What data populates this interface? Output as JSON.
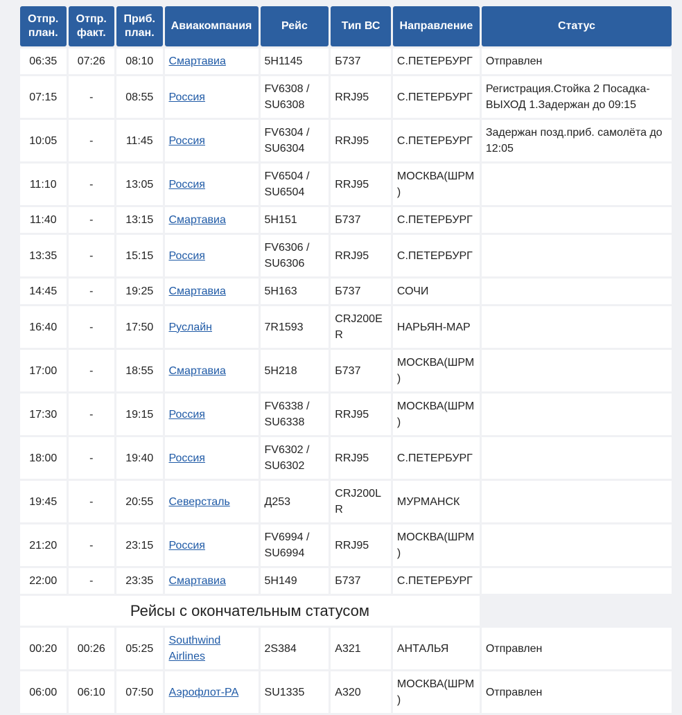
{
  "headers": {
    "dep_plan": "Отпр. план.",
    "dep_fact": "Отпр. факт.",
    "arr_plan": "Приб. план.",
    "airline": "Авиакомпания",
    "flight": "Рейс",
    "aircraft": "Тип ВС",
    "destination": "Направление",
    "status": "Статус"
  },
  "flights": [
    {
      "dep_plan": "06:35",
      "dep_fact": "07:26",
      "arr_plan": "08:10",
      "airline": "Смартавиа",
      "flight": "5Н1145",
      "aircraft": "Б737",
      "destination": "С.ПЕТЕРБУРГ",
      "status": "Отправлен"
    },
    {
      "dep_plan": "07:15",
      "dep_fact": "-",
      "arr_plan": "08:55",
      "airline": "Россия",
      "flight": "FV6308 / SU6308",
      "aircraft": "RRJ95",
      "destination": "С.ПЕТЕРБУРГ",
      "status": "Регистрация.Стойка 2 Посадка-ВЫХОД 1.Задержан до 09:15"
    },
    {
      "dep_plan": "10:05",
      "dep_fact": "-",
      "arr_plan": "11:45",
      "airline": "Россия",
      "flight": "FV6304 / SU6304",
      "aircraft": "RRJ95",
      "destination": "С.ПЕТЕРБУРГ",
      "status": "Задержан позд.приб. самолёта до 12:05"
    },
    {
      "dep_plan": "11:10",
      "dep_fact": "-",
      "arr_plan": "13:05",
      "airline": "Россия",
      "flight": "FV6504 / SU6504",
      "aircraft": "RRJ95",
      "destination": "МОСКВА(ШРМ)",
      "status": ""
    },
    {
      "dep_plan": "11:40",
      "dep_fact": "-",
      "arr_plan": "13:15",
      "airline": "Смартавиа",
      "flight": "5Н151",
      "aircraft": "Б737",
      "destination": "С.ПЕТЕРБУРГ",
      "status": ""
    },
    {
      "dep_plan": "13:35",
      "dep_fact": "-",
      "arr_plan": "15:15",
      "airline": "Россия",
      "flight": "FV6306 / SU6306",
      "aircraft": "RRJ95",
      "destination": "С.ПЕТЕРБУРГ",
      "status": ""
    },
    {
      "dep_plan": "14:45",
      "dep_fact": "-",
      "arr_plan": "19:25",
      "airline": "Смартавиа",
      "flight": "5Н163",
      "aircraft": "Б737",
      "destination": "СОЧИ",
      "status": ""
    },
    {
      "dep_plan": "16:40",
      "dep_fact": "-",
      "arr_plan": "17:50",
      "airline": "Руслайн",
      "flight": "7R1593",
      "aircraft": "CRJ200ER",
      "destination": "НАРЬЯН-МАР",
      "status": ""
    },
    {
      "dep_plan": "17:00",
      "dep_fact": "-",
      "arr_plan": "18:55",
      "airline": "Смартавиа",
      "flight": "5Н218",
      "aircraft": "Б737",
      "destination": "МОСКВА(ШРМ)",
      "status": ""
    },
    {
      "dep_plan": "17:30",
      "dep_fact": "-",
      "arr_plan": "19:15",
      "airline": "Россия",
      "flight": "FV6338 / SU6338",
      "aircraft": "RRJ95",
      "destination": "МОСКВА(ШРМ)",
      "status": ""
    },
    {
      "dep_plan": "18:00",
      "dep_fact": "-",
      "arr_plan": "19:40",
      "airline": "Россия",
      "flight": "FV6302 / SU6302",
      "aircraft": "RRJ95",
      "destination": "С.ПЕТЕРБУРГ",
      "status": ""
    },
    {
      "dep_plan": "19:45",
      "dep_fact": "-",
      "arr_plan": "20:55",
      "airline": "Северсталь",
      "flight": "Д253",
      "aircraft": "CRJ200LR",
      "destination": "МУРМАНСК",
      "status": ""
    },
    {
      "dep_plan": "21:20",
      "dep_fact": "-",
      "arr_plan": "23:15",
      "airline": "Россия",
      "flight": "FV6994 / SU6994",
      "aircraft": "RRJ95",
      "destination": "МОСКВА(ШРМ)",
      "status": ""
    },
    {
      "dep_plan": "22:00",
      "dep_fact": "-",
      "arr_plan": "23:35",
      "airline": "Смартавиа",
      "flight": "5Н149",
      "aircraft": "Б737",
      "destination": "С.ПЕТЕРБУРГ",
      "status": ""
    }
  ],
  "final_section": {
    "title": "Рейсы с окончательным статусом",
    "flights": [
      {
        "dep_plan": "00:20",
        "dep_fact": "00:26",
        "arr_plan": "05:25",
        "airline": "Southwind Airlines",
        "flight": "2S384",
        "aircraft": "A321",
        "destination": "АНТАЛЬЯ",
        "status": "Отправлен"
      },
      {
        "dep_plan": "06:00",
        "dep_fact": "06:10",
        "arr_plan": "07:50",
        "airline": "Аэрофлот-РА",
        "flight": "SU1335",
        "aircraft": "A320",
        "destination": "МОСКВА(ШРМ)",
        "status": "Отправлен"
      }
    ]
  },
  "colors": {
    "header_bg": "#2c5fa0",
    "link": "#1f5aa6",
    "page_bg": "#f0f1f4"
  }
}
